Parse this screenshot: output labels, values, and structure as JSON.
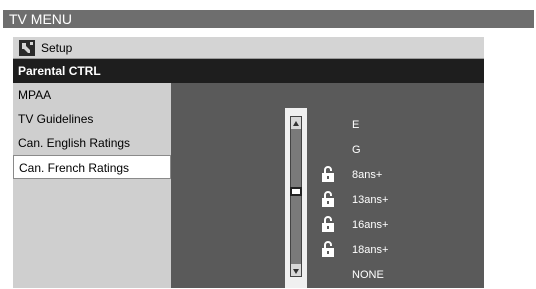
{
  "header": {
    "title": "TV MENU"
  },
  "setup": {
    "label": "Setup",
    "icon": "setup-wrench-icon"
  },
  "crumb": {
    "label": "Parental CTRL"
  },
  "menu": {
    "items": [
      {
        "label": "MPAA",
        "selected": false
      },
      {
        "label": "TV Guidelines",
        "selected": false
      },
      {
        "label": "Can. English Ratings",
        "selected": false
      },
      {
        "label": "Can. French Ratings",
        "selected": true
      }
    ]
  },
  "ratings": {
    "items": [
      {
        "label": "E",
        "locked": false
      },
      {
        "label": "G",
        "locked": false
      },
      {
        "label": "8ans+",
        "locked": true
      },
      {
        "label": "13ans+",
        "locked": true
      },
      {
        "label": "16ans+",
        "locked": true
      },
      {
        "label": "18ans+",
        "locked": true
      },
      {
        "label": "NONE",
        "locked": false
      }
    ]
  },
  "colors": {
    "panel_bg": "#5a5a5a",
    "header_bg": "#6e6e6e",
    "crumb_bg": "#1e1e1e",
    "menu_bg": "#cfcfcf"
  }
}
